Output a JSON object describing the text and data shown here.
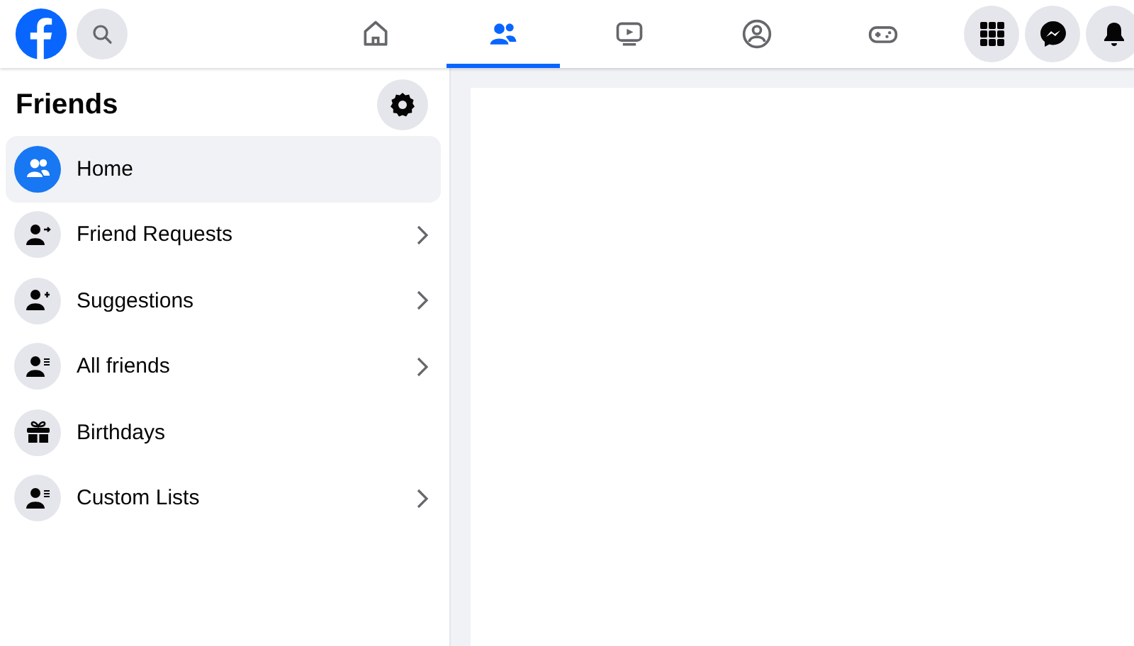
{
  "nav_tabs": [
    {
      "selected": false
    },
    {
      "selected": true
    },
    {
      "selected": false
    },
    {
      "selected": false
    },
    {
      "selected": false
    }
  ],
  "sidebar": {
    "title": "Friends",
    "items": [
      {
        "label": "Home",
        "selected": true,
        "submenu": false
      },
      {
        "label": "Friend Requests",
        "selected": false,
        "submenu": true
      },
      {
        "label": "Suggestions",
        "selected": false,
        "submenu": true
      },
      {
        "label": "All friends",
        "selected": false,
        "submenu": true
      },
      {
        "label": "Birthdays",
        "selected": false,
        "submenu": false
      },
      {
        "label": "Custom Lists",
        "selected": false,
        "submenu": true
      }
    ]
  }
}
